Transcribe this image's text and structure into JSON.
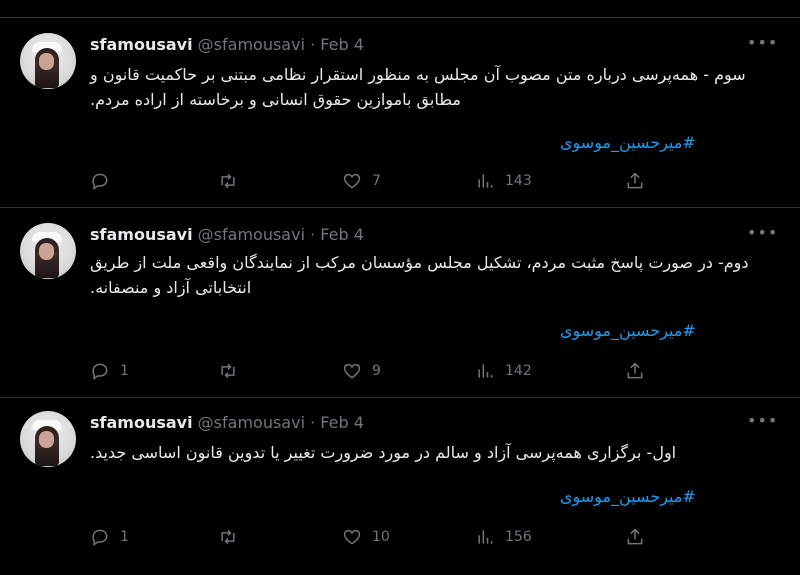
{
  "tweets": [
    {
      "name": "sfamousavi",
      "handle": "@sfamousavi",
      "separator": "·",
      "date": "Feb 4",
      "text": "سوم - همه‌پرسی درباره متن مصوب آن مجلس به منظور استقرار نظامی مبتنی بر حاکمیت قانون و مطابق باموازین حقوق انسانی و برخاسته از اراده مردم.",
      "hashtag": "#میرحسین_موسوی",
      "replies": "",
      "retweets": "",
      "likes": "7",
      "views": "143"
    },
    {
      "name": "sfamousavi",
      "handle": "@sfamousavi",
      "separator": "·",
      "date": "Feb 4",
      "text": "دوم- در صورت پاسخ مثبت مردم، تشکیل مجلس مؤسسان مرکب از نمایندگان واقعی ملت از طریق انتخاباتی آزاد و منصفانه.",
      "hashtag": "#میرحسین_موسوی",
      "replies": "1",
      "retweets": "",
      "likes": "9",
      "views": "142"
    },
    {
      "name": "sfamousavi",
      "handle": "@sfamousavi",
      "separator": "·",
      "date": "Feb 4",
      "text": "اول- برگزاری همه‌پرسی آزاد و سالم در مورد ضرورت تغییر یا تدوین قانون اساسی جدید.",
      "hashtag": "#میرحسین_موسوی",
      "replies": "1",
      "retweets": "",
      "likes": "10",
      "views": "156"
    }
  ],
  "more_icon": "more-dots-icon",
  "colors": {
    "background": "#000000",
    "text": "#e7e9ea",
    "muted": "#71767b",
    "link": "#1d9bf0",
    "border": "#2f3336"
  }
}
